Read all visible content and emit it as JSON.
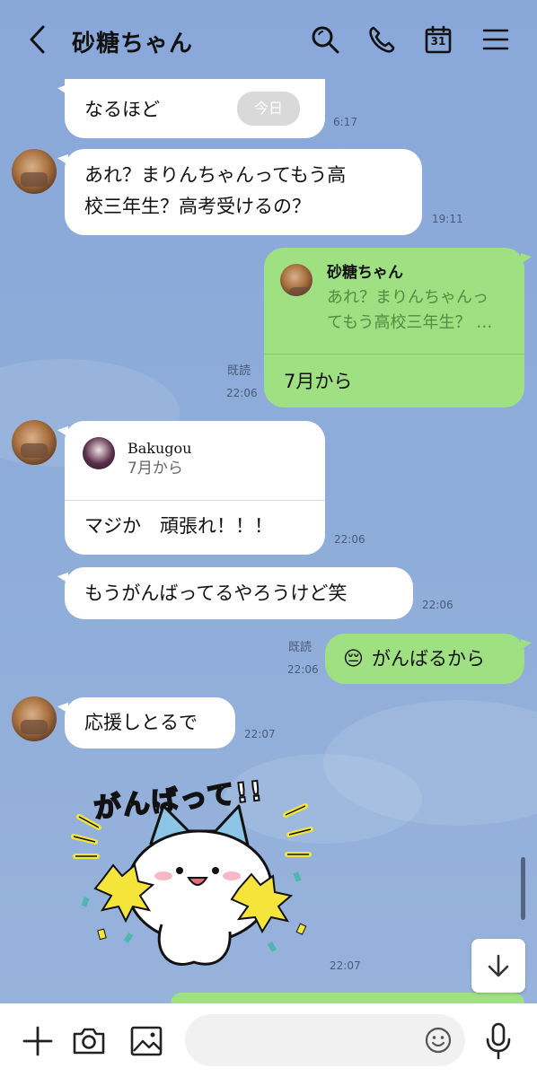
{
  "header": {
    "title": "砂糖ちゃん",
    "icons": [
      "back-icon",
      "search-icon",
      "phone-icon",
      "calendar-icon",
      "menu-icon"
    ],
    "calendar_day": "31"
  },
  "messages": {
    "m1": {
      "text": "なるほど",
      "pill": "今日",
      "time": "6:17"
    },
    "m2": {
      "line1": "あれ？まりんちゃんってもう高",
      "line2": "校三年生？高考受けるの？",
      "time": "19:11"
    },
    "m3": {
      "reply_name": "砂糖ちゃん",
      "reply_line1": "あれ？まりんちゃんっ",
      "reply_line2": "てもう高校三年生？ …",
      "text": "7月から",
      "read": "既読",
      "time": "22:06"
    },
    "m4": {
      "reply_name": "Bakugou",
      "reply_text": "7月から",
      "text": "マジか　頑張れ！！！",
      "time": "22:06"
    },
    "m5": {
      "text": "もうがんばってるやろうけど笑",
      "time": "22:06"
    },
    "m6": {
      "emoji": "😔",
      "text": "がんばるから",
      "read": "既読",
      "time": "22:06"
    },
    "m7": {
      "text": "応援しとるで",
      "time": "22:07"
    },
    "sticker": {
      "caption": "がんばって!!",
      "time": "22:07"
    }
  },
  "colors": {
    "background": "#8aa8d8",
    "outgoing_bubble": "#9ee082",
    "incoming_bubble": "#ffffff",
    "meta_text": "#4b5a78"
  },
  "bottom_bar": {
    "icons": [
      "plus-icon",
      "camera-icon",
      "image-icon",
      "emoji-icon",
      "mic-icon"
    ],
    "input_placeholder": ""
  }
}
